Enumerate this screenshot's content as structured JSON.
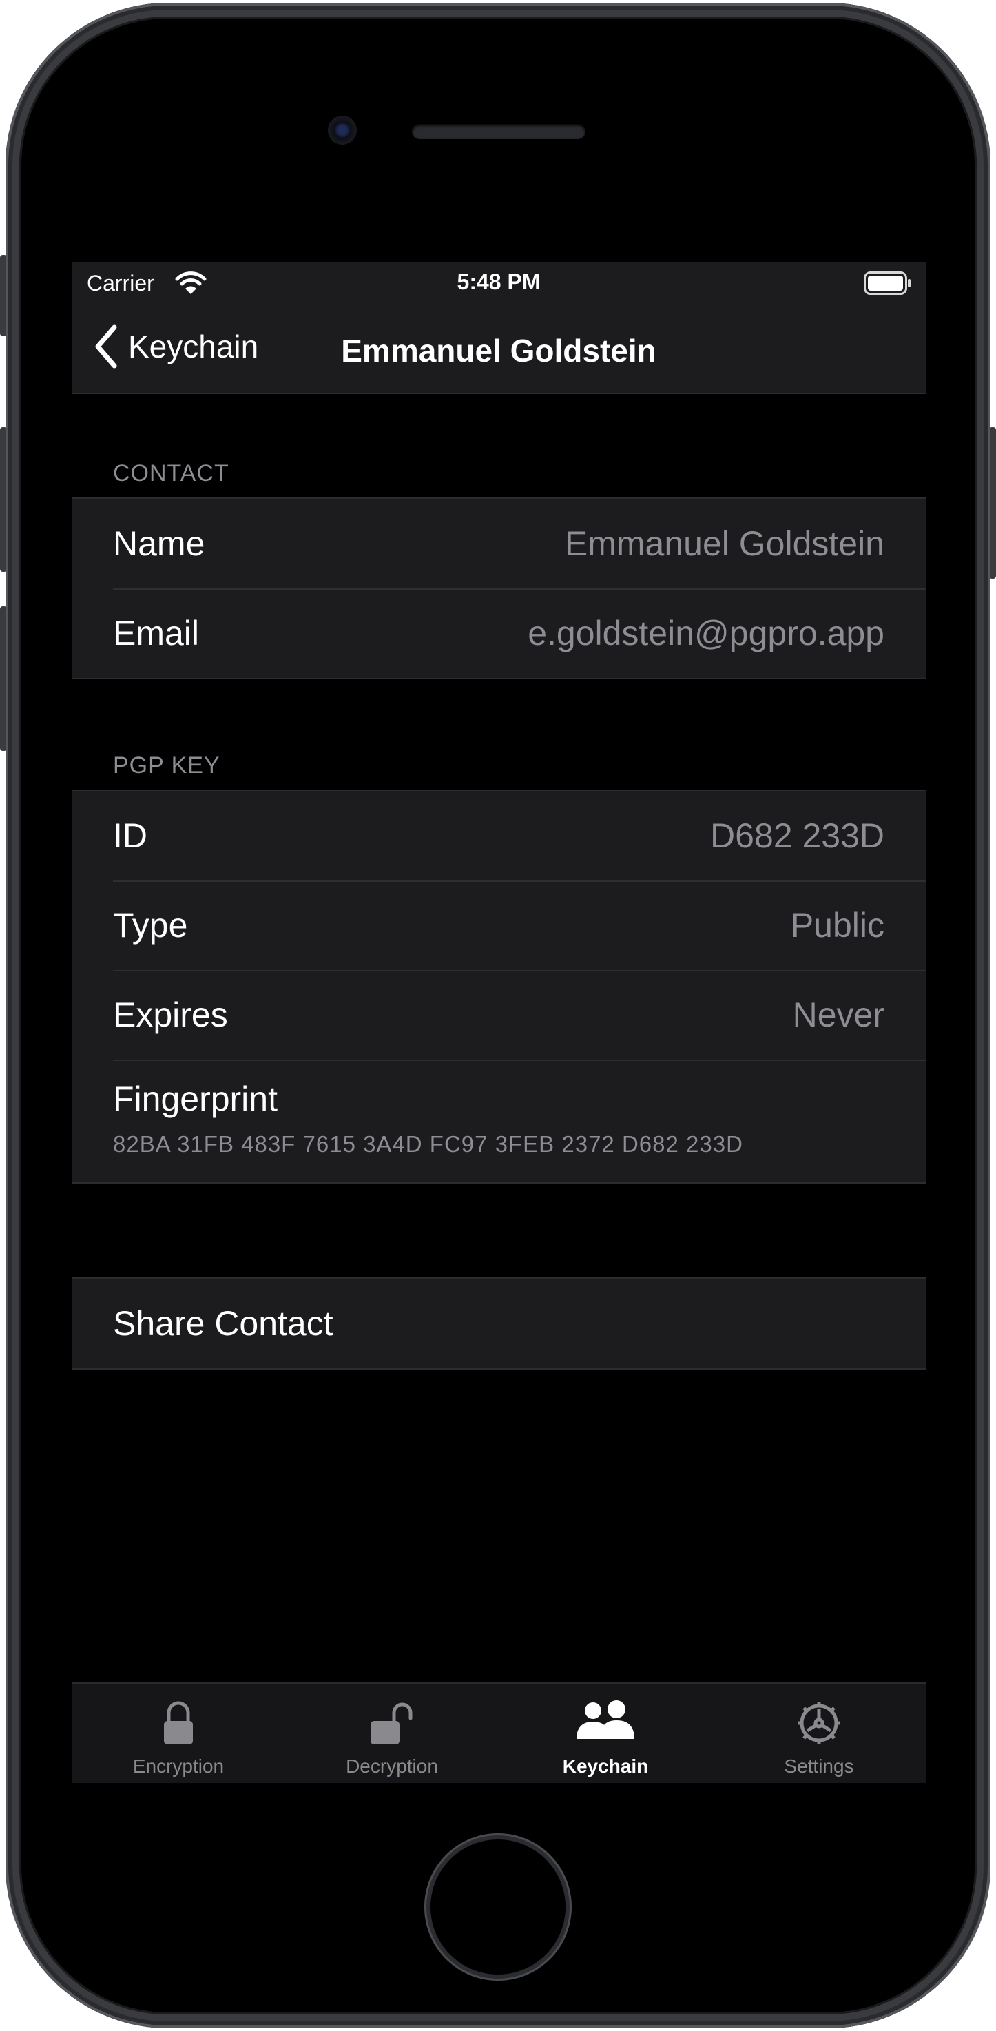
{
  "status_bar": {
    "carrier": "Carrier",
    "time": "5:48 PM"
  },
  "nav": {
    "back_label": "Keychain",
    "title": "Emmanuel Goldstein"
  },
  "contact_section": {
    "header": "CONTACT",
    "rows": [
      {
        "label": "Name",
        "value": "Emmanuel Goldstein"
      },
      {
        "label": "Email",
        "value": "e.goldstein@pgpro.app"
      }
    ]
  },
  "pgp_section": {
    "header": "PGP KEY",
    "rows": [
      {
        "label": "ID",
        "value": "D682 233D"
      },
      {
        "label": "Type",
        "value": "Public"
      },
      {
        "label": "Expires",
        "value": "Never"
      }
    ],
    "fingerprint": {
      "label": "Fingerprint",
      "value": "82BA 31FB 483F 7615 3A4D FC97 3FEB 2372 D682 233D"
    }
  },
  "actions": {
    "share_label": "Share Contact"
  },
  "tab_bar": {
    "tabs": [
      {
        "label": "Encryption",
        "icon": "lock-icon"
      },
      {
        "label": "Decryption",
        "icon": "unlock-icon"
      },
      {
        "label": "Keychain",
        "icon": "people-icon"
      },
      {
        "label": "Settings",
        "icon": "gear-icon"
      }
    ],
    "active": "Keychain"
  },
  "colors": {
    "background": "#000000",
    "cell": "#1c1c1e",
    "secondary_text": "#8d8d93",
    "primary_text": "#ffffff"
  }
}
